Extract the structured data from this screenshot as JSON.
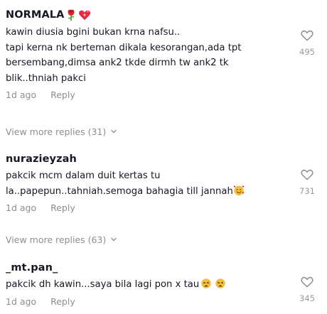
{
  "comments": [
    {
      "username": "NORMALA",
      "username_icons": [
        "rose-icon",
        "sparkling-heart-icon"
      ],
      "text_lines": [
        "kawin diusia bgini bukan krna nafsu..",
        "tapi kerna nk berteman dikala kesorangan,ada tpt",
        "bersembang,dimsa ank2 tkde dirmh tw ank2 tk",
        "blik..thniah pakci"
      ],
      "time": "1d ago",
      "reply_label": "Reply",
      "likes": "495",
      "view_more": "View more replies (31)"
    },
    {
      "username": "nurazieyzah",
      "text_lines": [
        "pakcik mcm dalam duit kertas tu",
        "la..papepun..tahniah.semoga bahagia till jannah"
      ],
      "text_emoji": "smiling-face-with-hearts-icon",
      "time": "1d ago",
      "reply_label": "Reply",
      "likes": "731",
      "view_more": "View more replies (63)"
    },
    {
      "username": "_mt.pan_",
      "text_lines": [
        "pakcik dh kawin...saya bila lagi pon x tau"
      ],
      "text_emoji": "weary-face-icon",
      "time": "1d ago",
      "reply_label": "Reply",
      "likes": "345"
    }
  ],
  "colors": {
    "text": "#161823",
    "muted": "rgba(22,24,35,0.5)",
    "background": "#ffffff"
  }
}
